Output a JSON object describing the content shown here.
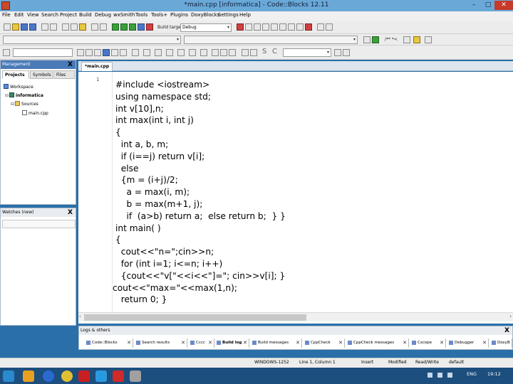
{
  "window": {
    "title": "*main.cpp [informatica] - Code::Blocks 12.11",
    "minimize": "–",
    "maximize": "□",
    "close": "✕"
  },
  "menubar": [
    "File",
    "Edit",
    "View",
    "Search",
    "Project",
    "Build",
    "Debug",
    "wxSmith",
    "Tools",
    "Tools+",
    "Plugins",
    "DoxyBlocks",
    "Settings",
    "Help"
  ],
  "toolbar": {
    "build_target_label": "Build target:",
    "build_target_value": "Debug",
    "comment_icons": "/** *<",
    "search_s": "S",
    "search_c": "C"
  },
  "management": {
    "title": "Management",
    "close": "X",
    "tabs": [
      "Projects",
      "Symbols",
      "Files"
    ],
    "tree": {
      "workspace": "Workspace",
      "project": "informatica",
      "folder": "Sources",
      "file": "main.cpp"
    }
  },
  "watches": {
    "title": "Watches (new)",
    "close": "X"
  },
  "editor": {
    "tab_label": "*main.cpp",
    "line_number": "1",
    "code_lines": [
      "#include <iostream>",
      "using namespace std;",
      "int v[10],n;",
      "int max(int i, int j)",
      "{",
      "  int a, b, m;",
      "  if (i==j) return v[i];",
      "  else",
      "  {m = (i+j)/2;",
      "    a = max(i, m);",
      "    b = max(m+1, j);",
      "    if  (a>b) return a;  else return b;  } }",
      "int main( )",
      "{",
      "  cout<<\"n=\";cin>>n;",
      "  for (int i=1; i<=n; i++)",
      "  {cout<<\"v[\"<<i<<\"]=\"; cin>>v[i]; }",
      "cout<<\"max=\"<<max(1,n);",
      "  return 0; }"
    ]
  },
  "logs": {
    "title": "Logs & others",
    "close": "X",
    "tabs": [
      "Code::Blocks",
      "Search results",
      "Cccc",
      "Build log",
      "Build messages",
      "CppCheck",
      "CppCheck messages",
      "Cscope",
      "Debugger",
      "DoxyB"
    ],
    "active_tab": "Build log"
  },
  "statusbar": {
    "encoding": "WINDOWS-1252",
    "position": "Line 1, Column 1",
    "mode": "Insert",
    "modified": "Modified",
    "access": "Read/Write",
    "profile": "default"
  },
  "taskbar": {
    "language": "ENG",
    "time": "19:12"
  }
}
